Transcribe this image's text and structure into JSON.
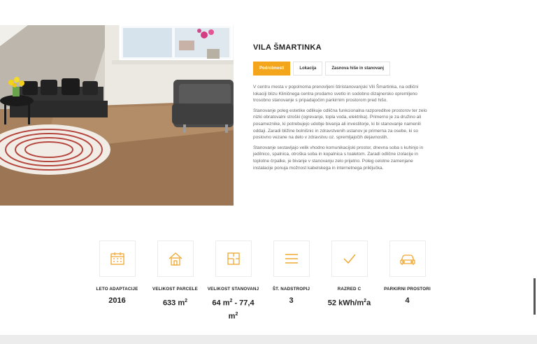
{
  "property": {
    "title": "VILA ŠMARTINKA"
  },
  "tabs": [
    {
      "label": "Podrobnosti",
      "active": true
    },
    {
      "label": "Lokacija",
      "active": false
    },
    {
      "label": "Zasnova hiše in stanovanj",
      "active": false
    }
  ],
  "description": [
    "V centru mesta v popolnoma prenovljeni štiristanovanjski Vili Šmartinka, na odlični lokaciji blizu Kliničnega centra prodamo svetlo in sodobno dizajnersko opremljeno trosobno stanovanje s pripadajočim parkirnim prostorom pred hišo.",
    "Stanovanje poleg estetike odlikuje odlična funkcionalna razporeditve prostorov ter zelo nizki obratovalni stroški (ogrevanje, topla voda, elektrika). Primerno je za družino ali posameznike, ki potrebujejo udobje bivanja ali investitorje, ki bi stanovanje namenili oddaji. Zaradi bližine bolnišnic in zdravstvenih ustanov je primerna za osebe, ki so poslovno vezane na delo v zdravstvu oz. spremljajočih dejavnostih.",
    "Stanovanje sestavljajo velik vhodno komunikacijski prostor, dnevna soba s kuhinjo in jedilnico, spalnica, otroška soba in kopalnica s toaletom. Zaradi odlične izolacije in toplotne črpalke, je bivanje v stanovanju zelo prijetno. Poleg celotne zamenjane instalacije ponuja možnost kabelskega in internetnega priključka."
  ],
  "stats": [
    {
      "icon": "calendar-icon",
      "label": "LETO ADAPTACIJE",
      "value": "2016",
      "sup": ""
    },
    {
      "icon": "house-icon",
      "label": "VELIKOST PARCELE",
      "value": "633 m",
      "sup": "2"
    },
    {
      "icon": "floorplan-icon",
      "label": "VELIKOST STANOVANJ",
      "value": "64 m",
      "sup": "2",
      "value2": " - 77,4",
      "value3": "m",
      "sup2": "2"
    },
    {
      "icon": "floors-icon",
      "label": "ŠT. NADSTROPIJ",
      "value": "3",
      "sup": ""
    },
    {
      "icon": "checkmark-icon",
      "label": "RAZRED C",
      "value": "52 kWh/m",
      "sup": "2",
      "suffix": "a"
    },
    {
      "icon": "car-icon",
      "label": "PARKIRNI PROSTORI",
      "value": "4",
      "sup": ""
    }
  ],
  "colors": {
    "accent": "#f3a51c",
    "icon": "#f0a830"
  }
}
